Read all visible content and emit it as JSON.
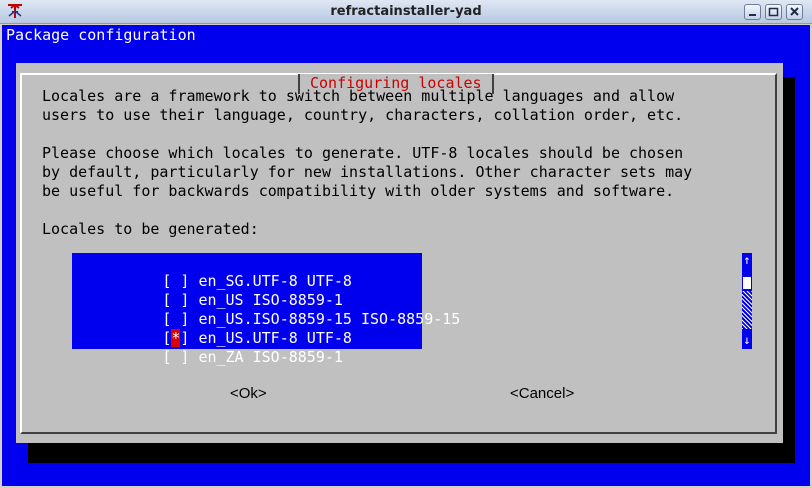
{
  "window": {
    "title": "refractainstaller-yad"
  },
  "terminal": {
    "heading": "Package configuration"
  },
  "dialog": {
    "title": "Configuring locales",
    "paragraph1": [
      "Locales are a framework to switch between multiple languages and allow",
      "users to use their language, country, characters, collation order, etc."
    ],
    "paragraph2": [
      "Please choose which locales to generate. UTF-8 locales should be chosen",
      "by default, particularly for new installations. Other character sets may",
      "be useful for backwards compatibility with older systems and software."
    ],
    "list_label": "Locales to be generated:",
    "locales": [
      {
        "checkbox": "[ ]",
        "label": "en_SG.UTF-8 UTF-8",
        "checked": false
      },
      {
        "checkbox": "[ ]",
        "label": "en_US ISO-8859-1",
        "checked": false
      },
      {
        "checkbox": "[ ]",
        "label": "en_US.ISO-8859-15 ISO-8859-15",
        "checked": false
      },
      {
        "checkbox": "[*]",
        "label": "en_US.UTF-8 UTF-8",
        "checked": true
      },
      {
        "checkbox": "[ ]",
        "label": "en_ZA ISO-8859-1",
        "checked": false
      }
    ],
    "scroll": {
      "up": "↑",
      "down": "↓"
    },
    "ok_label": "<Ok>",
    "cancel_label": "<Cancel>"
  },
  "colors": {
    "terminal_bg": "#0000ee",
    "dialog_bg": "#c0c0c0",
    "title_red": "#cc0000",
    "highlight_red": "#dd0000"
  }
}
